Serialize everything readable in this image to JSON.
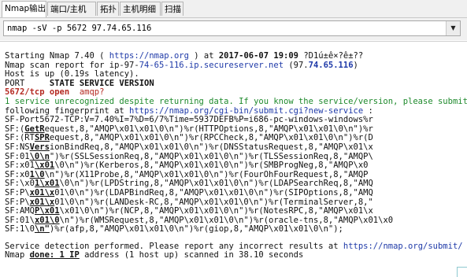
{
  "tabs": [
    "Nmap输出",
    "端口/主机",
    "拓扑",
    "主机明细",
    "扫描"
  ],
  "command": "nmap -sV -p 5672 97.74.65.116",
  "output": {
    "l1": {
      "a": "Starting Nmap 7.40 ( ",
      "b": "https://nmap.org",
      "c": " ) at ",
      "d": "2017-06-07 19:09",
      "e": " ?D1ú±ê×?ê±??"
    },
    "l2": {
      "a": "Nmap scan report for ip-97-",
      "b": "74-65-116.ip.secureserver.net",
      "c": " (97.",
      "d": "74.65.116",
      "e": ")"
    },
    "l3": "Host is up (0.19s latency).",
    "l4": {
      "a": "PORT     ",
      "b": "STATE SERVICE VERSION"
    },
    "l5": {
      "a": "5672/tcp open  ",
      "b": "amqp?"
    },
    "l6": {
      "a": "1 service unrecognized despite returning data. If you know the service/version, please submit the"
    },
    "l7": {
      "a": "following fingerprint at ",
      "b": "https://nmap.org/cgi-bin/submit.cgi?new-service",
      "c": " :"
    },
    "l8": "SF-Port5672-TCP:V=7.40%I=7%D=6/7%Time=5937DEFB%P=i686-pc-windows-windows%r",
    "l9": {
      "a": "SF:(",
      "b": "GetR",
      "c": "equest,8,\"AMQP\\x01\\x01\\0\\n\")%r(HTTPOptions,8,\"AMQP\\x01\\x01\\0\\n\")%r"
    },
    "l10": {
      "a": "SF:(RT",
      "b": "SPR",
      "c": "equest,8,\"AMQP\\x01\\x01\\0\\n\")%r(RPCCheck,8,\"AMQP\\x01\\x01\\0\\n\")%r(D"
    },
    "l11": {
      "a": "SF:NS",
      "b": "Vers",
      "c": "ionBindReq,8,\"AMQP\\x01\\x01\\0\\n\")%r(DNSStatusRequest,8,\"AMQP\\x01\\x"
    },
    "l12": {
      "a": "SF:01",
      "b": "\\0\\n",
      "c": "\")%r(SSLSessionReq,8,\"AMQP\\x01\\x01\\0\\n\")%r(TLSSessionReq,8,\"AMQP\\"
    },
    "l13": {
      "a": "SF:x01",
      "b": "\\x01",
      "c": "\\0\\n\")%r(Kerberos,8,\"AMQP\\x01\\x01\\0\\n\")%r(SMBProgNeg,8,\"AMQP\\x0"
    },
    "l14": {
      "a": "SF:x0",
      "b": "1\\0",
      "c": "\\n\")%r(X11Probe,8,\"AMQP\\x01\\x01\\0\\n\")%r(FourOhFourRequest,8,\"AMQP"
    },
    "l15": {
      "a": "SF:\\x0",
      "b": "1\\x01",
      "c": "\\0\\n\")%r(LPDString,8,\"AMQP\\x01\\x01\\0\\n\")%r(LDAPSearchReq,8,\"AMQ"
    },
    "l16": {
      "a": "SF:P\\",
      "b": "x01\\x",
      "c": "01\\0\\n\")%r(LDAPBindReq,8,\"AMQP\\x01\\x01\\0\\n\")%r(SIPOptions,8,\"AMQ"
    },
    "l17": {
      "a": "SF:P\\",
      "b": "x01\\x",
      "c": "01\\0\\n\")%r(LANDesk-RC,8,\"AMQP\\x01\\x01\\0\\n\")%r(TerminalServer,8,\""
    },
    "l18": {
      "a": "SF:AMQ",
      "b": "P\\x01",
      "c": "\\x01\\0\\n\")%r(NCP,8,\"AMQP\\x01\\x01\\0\\n\")%r(NotesRPC,8,\"AMQP\\x01\\x"
    },
    "l19": {
      "a": "SF:01\\",
      "b": "x01\\0",
      "c": "\\n\")%r(WMSRequest,8,\"AMQP\\x01\\x01\\0\\n\")%r(oracle-tns,8,\"AMQP\\x01\\x0"
    },
    "l20": {
      "a": "SF:1\\0",
      "b": "\\n\"",
      "c": ")%r(afp,8,\"AMQP\\x01\\x01\\0\\n\")%r(giop,8,\"AMQP\\x01\\x01\\0\\n\");"
    },
    "l21": {
      "a": "Service detection performed. Please report any incorrect results at ",
      "b": "https://nmap.org/submit/",
      "c": " ."
    },
    "l22": {
      "a": "Nmap ",
      "b": "done: 1 IP",
      "c": " address (1 host up) scanned in 38.10 seconds"
    }
  }
}
